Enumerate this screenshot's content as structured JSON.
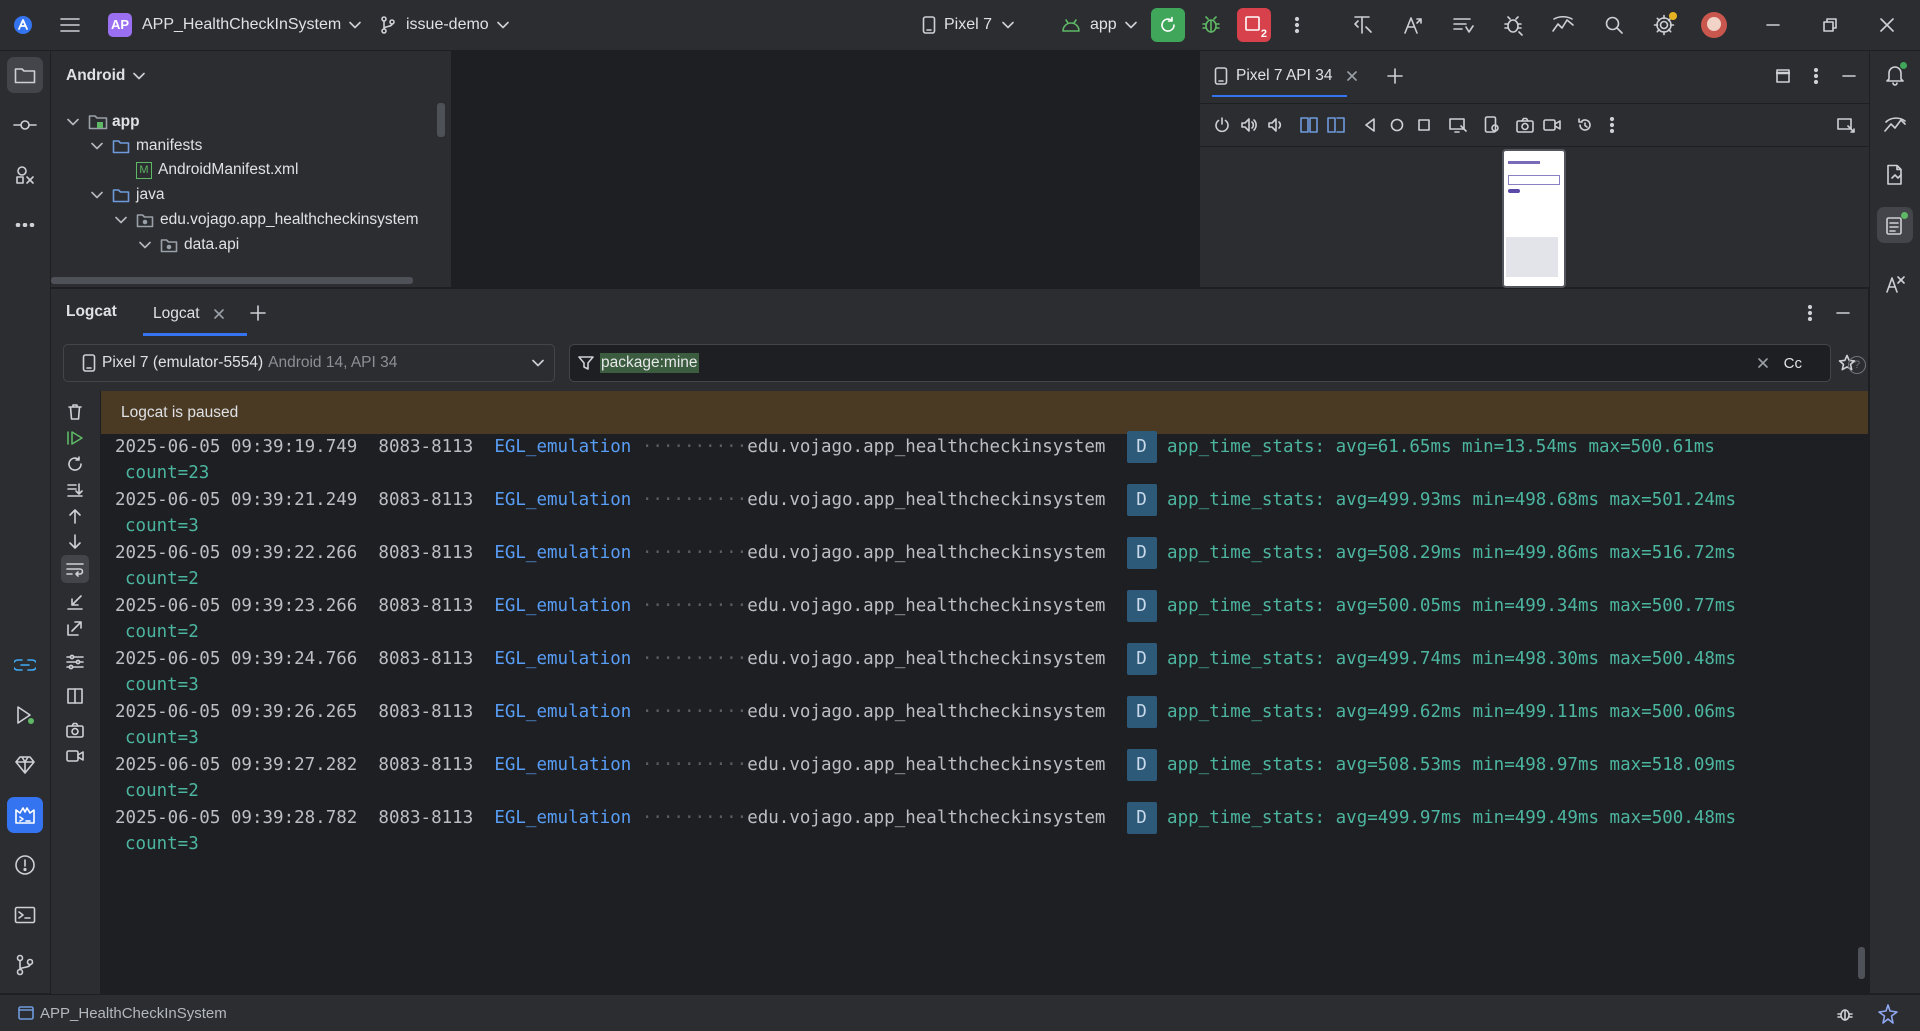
{
  "titlebar": {
    "project_badge": "AP",
    "project_name": "APP_HealthCheckInSystem",
    "branch": "issue-demo",
    "device": "Pixel 7",
    "run_config": "app",
    "notification_count": "2"
  },
  "project_panel": {
    "view_mode": "Android",
    "tree": [
      {
        "label": "app",
        "bold": true
      },
      {
        "label": "manifests"
      },
      {
        "label": "AndroidManifest.xml"
      },
      {
        "label": "java"
      },
      {
        "label": "edu.vojago.app_healthcheckinsystem"
      },
      {
        "label": "data.api"
      }
    ],
    "manifest_badge": "M"
  },
  "devices_panel": {
    "tab_label": "Pixel 7 API 34"
  },
  "logcat": {
    "tool_title": "Logcat",
    "tab_label": "Logcat",
    "device_select": {
      "name": "Pixel 7 (emulator-5554)",
      "detail": "Android 14, API 34"
    },
    "filter_value": "package:mine",
    "case_toggle": "Cc",
    "paused_banner": "Logcat is paused",
    "entries": [
      {
        "timestamp": "2025-06-05 09:39:19.749",
        "pid": "8083-8113",
        "tag": "EGL_emulation",
        "package": "edu.vojago.app_healthcheckinsystem",
        "level": "D",
        "message": "app_time_stats: avg=61.65ms min=13.54ms max=500.61ms",
        "count": "count=23"
      },
      {
        "timestamp": "2025-06-05 09:39:21.249",
        "pid": "8083-8113",
        "tag": "EGL_emulation",
        "package": "edu.vojago.app_healthcheckinsystem",
        "level": "D",
        "message": "app_time_stats: avg=499.93ms min=498.68ms max=501.24ms",
        "count": "count=3"
      },
      {
        "timestamp": "2025-06-05 09:39:22.266",
        "pid": "8083-8113",
        "tag": "EGL_emulation",
        "package": "edu.vojago.app_healthcheckinsystem",
        "level": "D",
        "message": "app_time_stats: avg=508.29ms min=499.86ms max=516.72ms",
        "count": "count=2"
      },
      {
        "timestamp": "2025-06-05 09:39:23.266",
        "pid": "8083-8113",
        "tag": "EGL_emulation",
        "package": "edu.vojago.app_healthcheckinsystem",
        "level": "D",
        "message": "app_time_stats: avg=500.05ms min=499.34ms max=500.77ms",
        "count": "count=2"
      },
      {
        "timestamp": "2025-06-05 09:39:24.766",
        "pid": "8083-8113",
        "tag": "EGL_emulation",
        "package": "edu.vojago.app_healthcheckinsystem",
        "level": "D",
        "message": "app_time_stats: avg=499.74ms min=498.30ms max=500.48ms",
        "count": "count=3"
      },
      {
        "timestamp": "2025-06-05 09:39:26.265",
        "pid": "8083-8113",
        "tag": "EGL_emulation",
        "package": "edu.vojago.app_healthcheckinsystem",
        "level": "D",
        "message": "app_time_stats: avg=499.62ms min=499.11ms max=500.06ms",
        "count": "count=3"
      },
      {
        "timestamp": "2025-06-05 09:39:27.282",
        "pid": "8083-8113",
        "tag": "EGL_emulation",
        "package": "edu.vojago.app_healthcheckinsystem",
        "level": "D",
        "message": "app_time_stats: avg=508.53ms min=498.97ms max=518.09ms",
        "count": "count=2"
      },
      {
        "timestamp": "2025-06-05 09:39:28.782",
        "pid": "8083-8113",
        "tag": "EGL_emulation",
        "package": "edu.vojago.app_healthcheckinsystem",
        "level": "D",
        "message": "app_time_stats: avg=499.97ms min=499.49ms max=500.48ms",
        "count": "count=3"
      }
    ]
  },
  "statusbar": {
    "project": "APP_HealthCheckInSystem"
  },
  "colors": {
    "background": "#1e1f22",
    "panel": "#2b2d30",
    "accent_blue": "#3574f0",
    "run_green": "#3fa65a",
    "badge_red": "#d6414b",
    "paused_banner": "#4a3a23",
    "log_tag": "#589df6",
    "log_message": "#4cb5a0",
    "log_level_bg": "#2e5a7a"
  }
}
